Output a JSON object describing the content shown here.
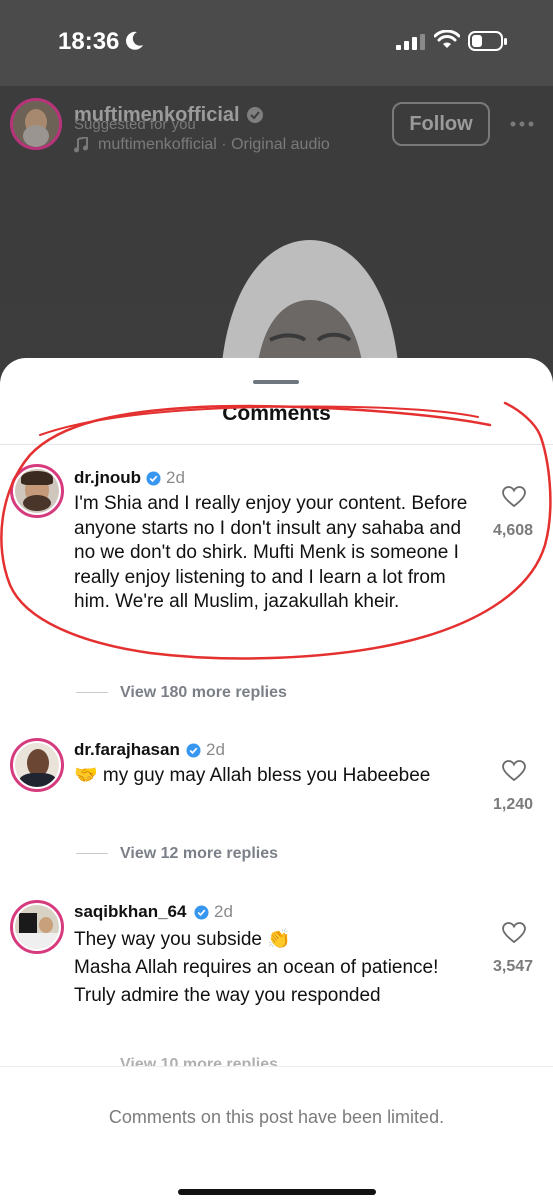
{
  "status_bar": {
    "time": "18:36"
  },
  "header": {
    "username": "muftimenkofficial",
    "suggested": "Suggested for you",
    "audio": "muftimenkofficial · Original audio",
    "follow_label": "Follow"
  },
  "sheet": {
    "title": "Comments"
  },
  "comments": [
    {
      "username": "dr.jnoub",
      "time": "2d",
      "text": "I'm Shia and I really enjoy your content. Before anyone starts no I don't insult any sahaba and no we don't do shirk. Mufti Menk is someone I really enjoy listening to and I learn a lot from him. We're all Muslim, jazakullah kheir.",
      "likes": "4,608",
      "replies": "View 180 more replies"
    },
    {
      "username": "dr.farajhasan",
      "time": "2d",
      "text": "🤝 my guy may Allah bless you Habeebee",
      "likes": "1,240",
      "replies": "View 12 more replies"
    },
    {
      "username": "saqibkhan_64",
      "time": "2d",
      "text_line1": "They way you subside 👏",
      "text_line2": "Masha Allah requires an ocean of patience!",
      "text_line3": "Truly admire the way you responded",
      "likes": "3,547",
      "replies": "View 10 more replies"
    }
  ],
  "footer": {
    "limited_text": "Comments on this post have been limited."
  },
  "colors": {
    "annotation": "#e53030",
    "verified": "#3797f0",
    "avatar_ring": "#d63b7e"
  }
}
